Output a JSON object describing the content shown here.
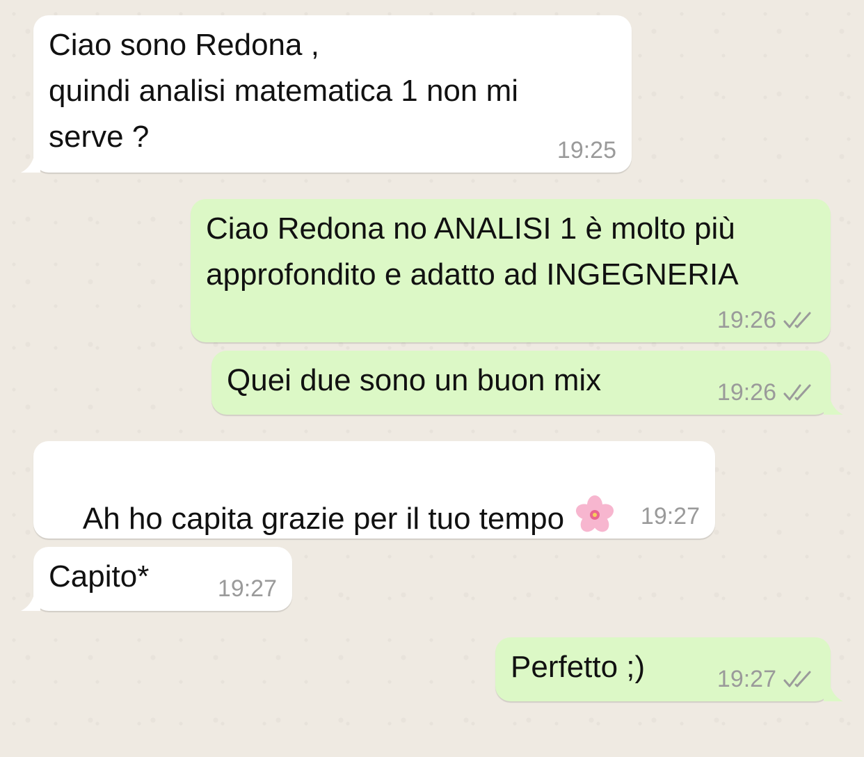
{
  "conversation": {
    "messages": [
      {
        "direction": "incoming",
        "text": "Ciao sono Redona ,\nquindi analisi matematica 1 non mi\nserve ?",
        "time": "19:25"
      },
      {
        "direction": "outgoing",
        "text": "Ciao Redona no ANALISI 1 è molto più\napprofondito e adatto ad INGEGNERIA",
        "time": "19:26",
        "status_icon": "double-check-icon"
      },
      {
        "direction": "outgoing",
        "text": "Quei due sono un buon mix",
        "time": "19:26",
        "status_icon": "double-check-icon"
      },
      {
        "direction": "incoming",
        "text": "Ah ho capita grazie per il tuo tempo",
        "emoji": "cherry-blossom-icon",
        "time": "19:27"
      },
      {
        "direction": "incoming",
        "text": "Capito*",
        "time": "19:27"
      },
      {
        "direction": "outgoing",
        "text": "Perfetto ;)",
        "time": "19:27",
        "status_icon": "double-check-icon"
      }
    ]
  },
  "colors": {
    "incoming_bubble": "#ffffff",
    "outgoing_bubble": "#dcf8c6",
    "wallpaper": "#efeae2",
    "timestamp": "#9a9a9a"
  }
}
